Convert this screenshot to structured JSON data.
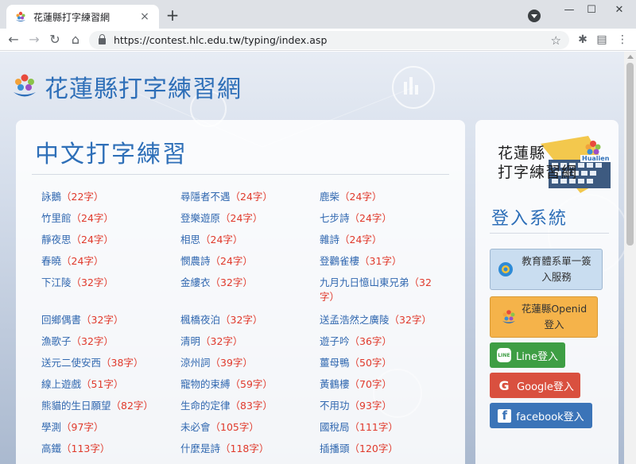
{
  "browser": {
    "tab_title": "花蓮縣打字練習網",
    "tab_close": "×",
    "new_tab": "+",
    "url": "https://contest.hlc.edu.tw/typing/index.asp",
    "window": {
      "minimize": "—",
      "maximize": "☐",
      "close": "✕"
    }
  },
  "site": {
    "title": "花蓮縣打字練習網"
  },
  "main": {
    "title": "中文打字練習",
    "items": [
      {
        "name": "詠鵝",
        "count": "（22字）"
      },
      {
        "name": "尋隱者不遇",
        "count": "（24字）"
      },
      {
        "name": "鹿柴",
        "count": "（24字）"
      },
      {
        "name": "竹里館",
        "count": "（24字）"
      },
      {
        "name": "登樂遊原",
        "count": "（24字）"
      },
      {
        "name": "七步詩",
        "count": "（24字）"
      },
      {
        "name": "靜夜思",
        "count": "（24字）"
      },
      {
        "name": "相思",
        "count": "（24字）"
      },
      {
        "name": "雜詩",
        "count": "（24字）"
      },
      {
        "name": "春曉",
        "count": "（24字）"
      },
      {
        "name": "憫農詩",
        "count": "（24字）"
      },
      {
        "name": "登鸛雀樓",
        "count": "（31字）"
      },
      {
        "name": "下江陵",
        "count": "（32字）"
      },
      {
        "name": "金縷衣",
        "count": "（32字）"
      },
      {
        "name": "九月九日憶山東兄弟",
        "count": "（32字）"
      },
      {
        "name": "回鄉偶書",
        "count": "（32字）"
      },
      {
        "name": "楓橋夜泊",
        "count": "（32字）"
      },
      {
        "name": "送孟浩然之廣陵",
        "count": "（32字）"
      },
      {
        "name": "漁歌子",
        "count": "（32字）"
      },
      {
        "name": "清明",
        "count": "（32字）"
      },
      {
        "name": "遊子吟",
        "count": "（36字）"
      },
      {
        "name": "送元二使安西",
        "count": "（38字）"
      },
      {
        "name": "涼州詞",
        "count": "（39字）"
      },
      {
        "name": "薑母鴨",
        "count": "（50字）"
      },
      {
        "name": "線上遊戲",
        "count": "（51字）"
      },
      {
        "name": "寵物的束縛",
        "count": "（59字）"
      },
      {
        "name": "黃鶴樓",
        "count": "（70字）"
      },
      {
        "name": "熊貓的生日願望",
        "count": "（82字）"
      },
      {
        "name": "生命的定律",
        "count": "（83字）"
      },
      {
        "name": "不用功",
        "count": "（93字）"
      },
      {
        "name": "學測",
        "count": "（97字）"
      },
      {
        "name": "未必會",
        "count": "（105字）"
      },
      {
        "name": "國稅局",
        "count": "（111字）"
      },
      {
        "name": "高鐵",
        "count": "（113字）"
      },
      {
        "name": "什麼是詩",
        "count": "（118字）"
      },
      {
        "name": "插播頭",
        "count": "（120字）"
      }
    ]
  },
  "side": {
    "logo_line1": "花蓮縣",
    "logo_line2": "打字練習網",
    "logo_badge": "Hualien",
    "login_title": "登入系統",
    "moe_btn": "教育體系單一簽入服務",
    "hlc_btn_line1": "花蓮縣Openid",
    "hlc_btn_line2": "登入",
    "line_btn": "Line登入",
    "google_btn": "Google登入",
    "fb_btn": "facebook登入",
    "line_icon_text": "LINE"
  },
  "colors": {
    "title_blue": "#2e6fb8",
    "count_red": "#e0392b",
    "line_green": "#3e9e44",
    "google_red": "#d9503f",
    "facebook_blue": "#3b74b8",
    "openid_orange": "#f5b34a"
  }
}
